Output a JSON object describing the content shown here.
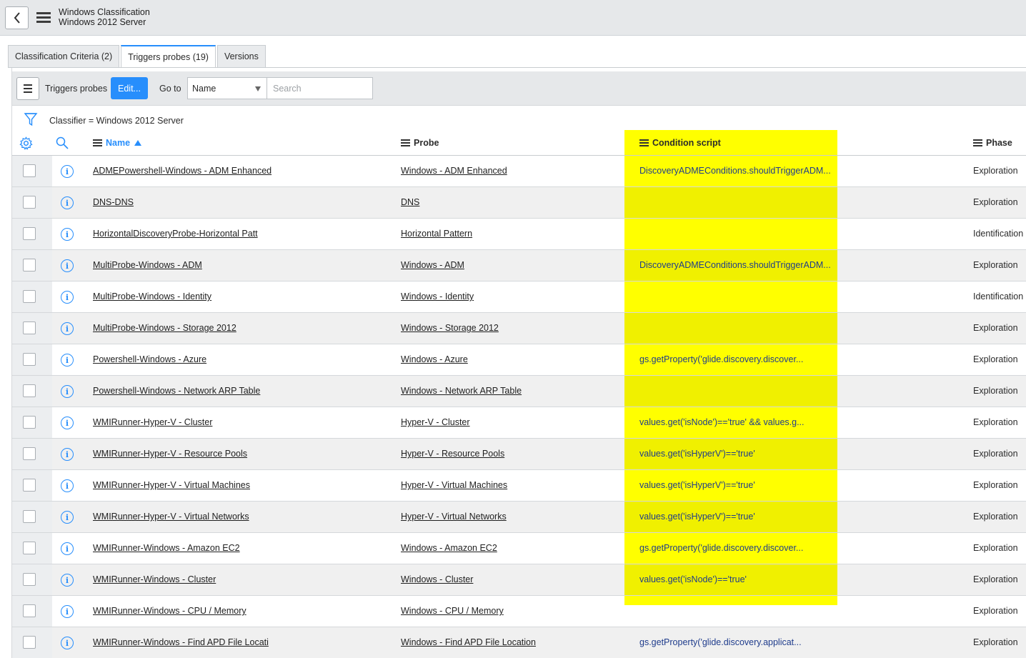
{
  "header": {
    "title": "Windows Classification",
    "subtitle": "Windows 2012 Server"
  },
  "tabs": [
    {
      "label": "Classification Criteria (2)",
      "active": false
    },
    {
      "label": "Triggers probes (19)",
      "active": true
    },
    {
      "label": "Versions",
      "active": false
    }
  ],
  "toolbar": {
    "list_label": "Triggers probes",
    "edit_label": "Edit...",
    "goto_label": "Go to",
    "goto_selected": "Name",
    "search_placeholder": "Search"
  },
  "breadcrumb": "Classifier = Windows 2012 Server",
  "columns": {
    "name": "Name",
    "probe": "Probe",
    "condition": "Condition script",
    "phase": "Phase"
  },
  "colors": {
    "accent": "#278efc",
    "highlight": "#ffff00"
  },
  "rows": [
    {
      "name": "ADMEPowershell-Windows - ADM Enhanced",
      "probe": "Windows - ADM Enhanced",
      "condition": "DiscoveryADMEConditions.shouldTriggerADM...",
      "phase": "Exploration"
    },
    {
      "name": "DNS-DNS",
      "probe": "DNS",
      "condition": "",
      "phase": "Exploration"
    },
    {
      "name": "HorizontalDiscoveryProbe-Horizontal Patt",
      "probe": "Horizontal Pattern",
      "condition": "",
      "phase": "Identification"
    },
    {
      "name": "MultiProbe-Windows - ADM",
      "probe": "Windows - ADM",
      "condition": "DiscoveryADMEConditions.shouldTriggerADM...",
      "phase": "Exploration"
    },
    {
      "name": "MultiProbe-Windows - Identity",
      "probe": "Windows - Identity",
      "condition": "",
      "phase": "Identification"
    },
    {
      "name": "MultiProbe-Windows - Storage 2012",
      "probe": "Windows - Storage 2012",
      "condition": "",
      "phase": "Exploration"
    },
    {
      "name": "Powershell-Windows - Azure",
      "probe": "Windows - Azure",
      "condition": "gs.getProperty('glide.discovery.discover...",
      "phase": "Exploration"
    },
    {
      "name": "Powershell-Windows - Network ARP Table",
      "probe": "Windows - Network ARP Table",
      "condition": "",
      "phase": "Exploration"
    },
    {
      "name": "WMIRunner-Hyper-V - Cluster",
      "probe": "Hyper-V - Cluster",
      "condition": "values.get('isNode')=='true' && values.g...",
      "phase": "Exploration"
    },
    {
      "name": "WMIRunner-Hyper-V - Resource Pools",
      "probe": "Hyper-V - Resource Pools",
      "condition": "values.get('isHyperV')=='true'",
      "phase": "Exploration"
    },
    {
      "name": "WMIRunner-Hyper-V - Virtual Machines",
      "probe": "Hyper-V - Virtual Machines",
      "condition": "values.get('isHyperV')=='true'",
      "phase": "Exploration"
    },
    {
      "name": "WMIRunner-Hyper-V - Virtual Networks",
      "probe": "Hyper-V - Virtual Networks",
      "condition": "values.get('isHyperV')=='true'",
      "phase": "Exploration"
    },
    {
      "name": "WMIRunner-Windows - Amazon EC2",
      "probe": "Windows - Amazon EC2",
      "condition": "gs.getProperty('glide.discovery.discover...",
      "phase": "Exploration"
    },
    {
      "name": "WMIRunner-Windows - Cluster",
      "probe": "Windows - Cluster",
      "condition": "values.get('isNode')=='true'",
      "phase": "Exploration"
    },
    {
      "name": "WMIRunner-Windows - CPU / Memory",
      "probe": "Windows - CPU / Memory",
      "condition": "",
      "phase": "Exploration"
    },
    {
      "name": "WMIRunner-Windows - Find APD File Locati",
      "probe": "Windows - Find APD File Location",
      "condition": "gs.getProperty('glide.discovery.applicat...",
      "phase": "Exploration"
    }
  ]
}
